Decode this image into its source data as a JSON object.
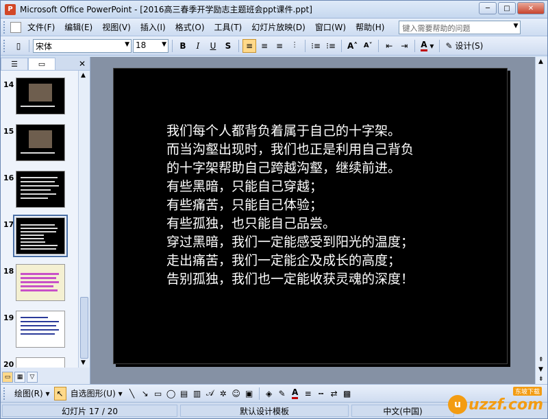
{
  "window": {
    "app_icon": "P",
    "title": "Microsoft Office PowerPoint - [2016高三春季开学励志主题班会ppt课件.ppt]",
    "controls": [
      "─",
      "□",
      "✕"
    ]
  },
  "menu": {
    "items": [
      "文件(F)",
      "编辑(E)",
      "视图(V)",
      "插入(I)",
      "格式(O)",
      "工具(T)",
      "幻灯片放映(D)",
      "窗口(W)",
      "帮助(H)"
    ],
    "help_placeholder": "键入需要帮助的问题"
  },
  "toolbar": {
    "font_name": "宋体",
    "font_size": "18",
    "bold": "B",
    "italic": "I",
    "underline": "U",
    "shadow": "S",
    "design_label": "设计(S)",
    "font_color": "#c00000"
  },
  "panel": {
    "tabs": [
      "outline-tab",
      "slides-tab"
    ],
    "close": "✕",
    "slides": [
      {
        "num": "14",
        "type": "photo"
      },
      {
        "num": "15",
        "type": "photo"
      },
      {
        "num": "16",
        "type": "text"
      },
      {
        "num": "17",
        "type": "text",
        "selected": true
      },
      {
        "num": "18",
        "type": "pink"
      },
      {
        "num": "19",
        "type": "white"
      },
      {
        "num": "20",
        "type": "green"
      }
    ]
  },
  "slide": {
    "lines": [
      "我们每个人都背负着属于自己的十字架。",
      "而当沟壑出现时，我们也正是利用自己背负",
      "的十字架帮助自己跨越沟壑，继续前进。",
      "有些黑暗，只能自己穿越；",
      "有些痛苦，只能自己体验；",
      "有些孤独，也只能自己品尝。",
      "穿过黑暗，我们一定能感受到阳光的温度；",
      "走出痛苦，我们一定能企及成长的高度；",
      "告别孤独，我们也一定能收获灵魂的深度！"
    ]
  },
  "drawbar": {
    "draw_label": "绘图(R)",
    "autoshapes_label": "自选图形(U)"
  },
  "status": {
    "slide_info": "幻灯片 17 / 20",
    "template": "默认设计模板",
    "language": "中文(中国)"
  },
  "watermark": {
    "badge": "u",
    "text": "uzzf.com",
    "sub": "东坡下载"
  }
}
